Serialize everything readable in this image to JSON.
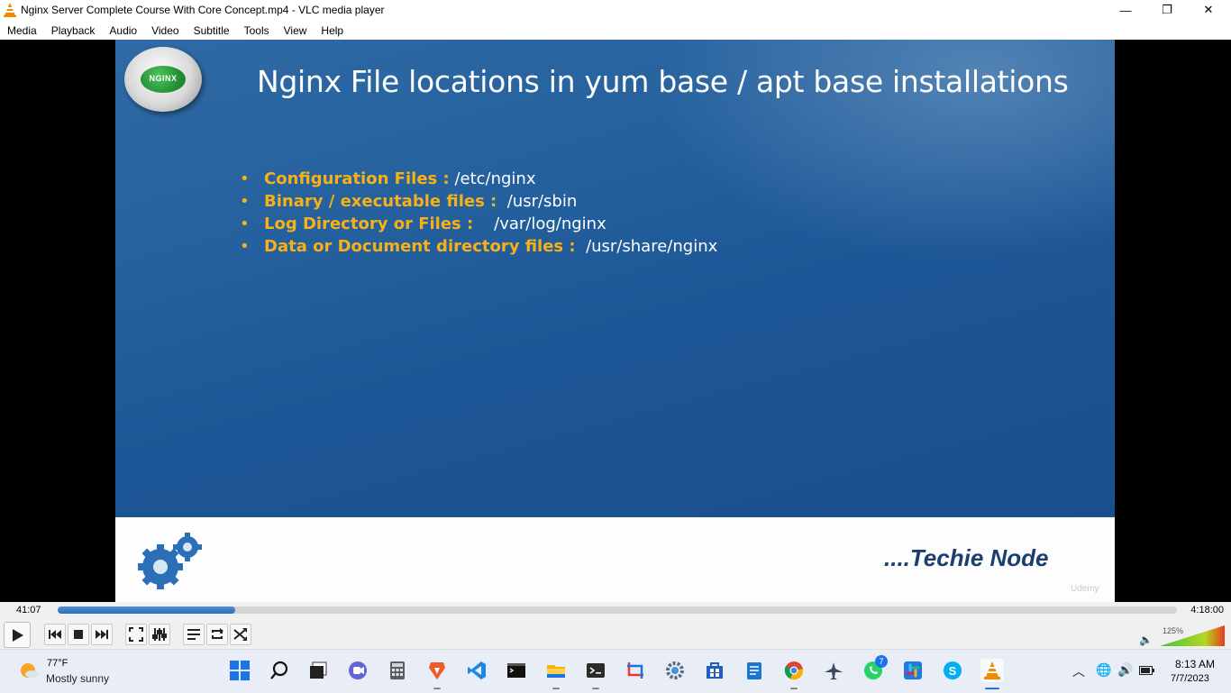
{
  "window": {
    "title": "Nginx Server Complete Course With Core Concept.mp4 - VLC media player",
    "minimize_glyph": "—",
    "maximize_glyph": "❐",
    "close_glyph": "✕"
  },
  "menu": {
    "items": [
      "Media",
      "Playback",
      "Audio",
      "Video",
      "Subtitle",
      "Tools",
      "View",
      "Help"
    ]
  },
  "slide": {
    "logo_text": "NGINX",
    "title": "Nginx File locations in yum base / apt base installations",
    "bullets": [
      {
        "label": "Configuration Files :",
        "value": "/etc/nginx"
      },
      {
        "label": "Binary / executable files :",
        "value": "/usr/sbin"
      },
      {
        "label": "Log Directory or Files :",
        "value": "/var/log/nginx"
      },
      {
        "label": "Data or Document directory files :",
        "value": "/usr/share/nginx"
      }
    ],
    "footer_brand": "....Techie Node",
    "watermark": "Udemy",
    "accent_color": "#f7b117"
  },
  "player": {
    "elapsed": "41:07",
    "total": "4:18:00",
    "progress_fraction": 0.159,
    "volume_label": "125%",
    "volume_fraction": 1.0
  },
  "taskbar": {
    "weather_temp": "77°F",
    "weather_condition": "Mostly sunny",
    "whatsapp_badge": "7",
    "time": "8:13 AM",
    "date": "7/7/2023"
  }
}
